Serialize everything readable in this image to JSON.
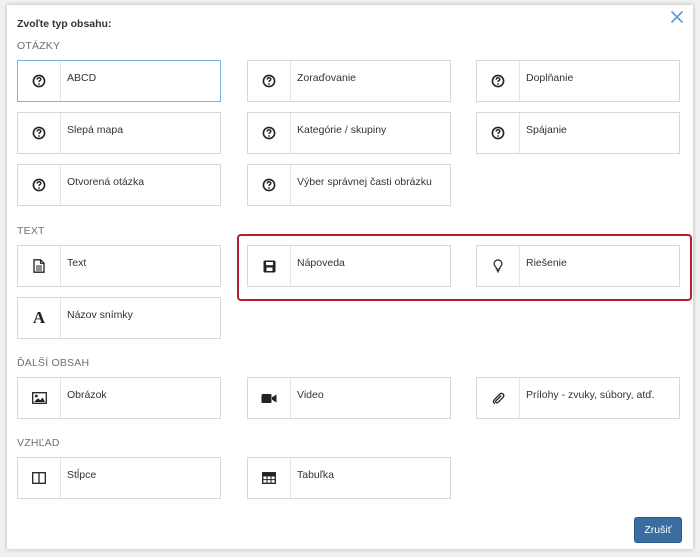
{
  "dialog": {
    "title": "Zvoľte typ obsahu:",
    "cancel_label": "Zrušiť"
  },
  "sections": {
    "questions": {
      "label": "OTÁZKY",
      "items": [
        {
          "label": "ABCD",
          "icon": "question-circle-icon",
          "selected": true
        },
        {
          "label": "Zoraďovanie",
          "icon": "question-circle-icon"
        },
        {
          "label": "Doplňanie",
          "icon": "question-circle-icon"
        },
        {
          "label": "Slepá mapa",
          "icon": "question-circle-icon"
        },
        {
          "label": "Kategórie / skupiny",
          "icon": "question-circle-icon"
        },
        {
          "label": "Spájanie",
          "icon": "question-circle-icon"
        },
        {
          "label": "Otvorená otázka",
          "icon": "question-circle-icon"
        },
        {
          "label": "Výber správnej časti obrázku",
          "icon": "question-circle-icon"
        }
      ]
    },
    "text": {
      "label": "TEXT",
      "items": [
        {
          "label": "Text",
          "icon": "document-icon"
        },
        {
          "label": "Nápoveda",
          "icon": "save-icon"
        },
        {
          "label": "Riešenie",
          "icon": "lightbulb-icon"
        },
        {
          "label": "Názov snímky",
          "icon": "font-letter-icon"
        }
      ]
    },
    "other": {
      "label": "ĎALŠÍ OBSAH",
      "items": [
        {
          "label": "Obrázok",
          "icon": "image-icon"
        },
        {
          "label": "Video",
          "icon": "video-camera-icon"
        },
        {
          "label": "Prílohy - zvuky, súbory, atď.",
          "icon": "paperclip-icon"
        }
      ]
    },
    "layout": {
      "label": "VZHĽAD",
      "items": [
        {
          "label": "Stĺpce",
          "icon": "columns-icon"
        },
        {
          "label": "Tabuľka",
          "icon": "table-icon"
        }
      ]
    }
  },
  "colors": {
    "highlight": "#b5212b",
    "selected_border": "#7ab3e0",
    "primary_button": "#3a6ea0"
  }
}
